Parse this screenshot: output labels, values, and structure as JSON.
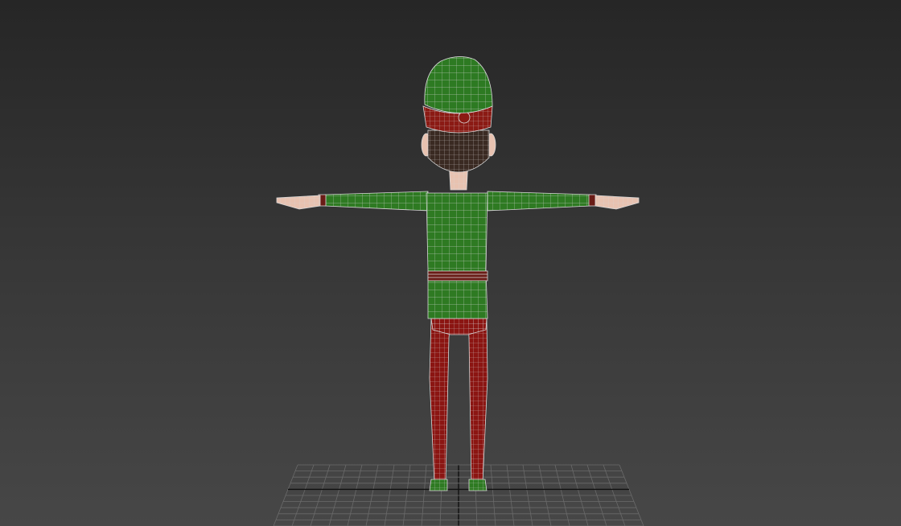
{
  "viewport": {
    "view_type": "3d-viewport-front-view",
    "display_mode": "shaded-with-wireframe",
    "grid": true
  },
  "model": {
    "pose": "t-pose",
    "colors": {
      "hat": "#2d7a22",
      "hat_band": "#8b1a14",
      "hair": "#3a2a22",
      "skin": "#e8c2b0",
      "shirt": "#2e7a22",
      "belt": "#6a1c16",
      "pants": "#8b1512",
      "shoes": "#2e7a22",
      "wireframe": "#d8d8d8"
    }
  },
  "grid": {
    "line_color": "#6a6a6a",
    "axis_color": "#101010"
  }
}
